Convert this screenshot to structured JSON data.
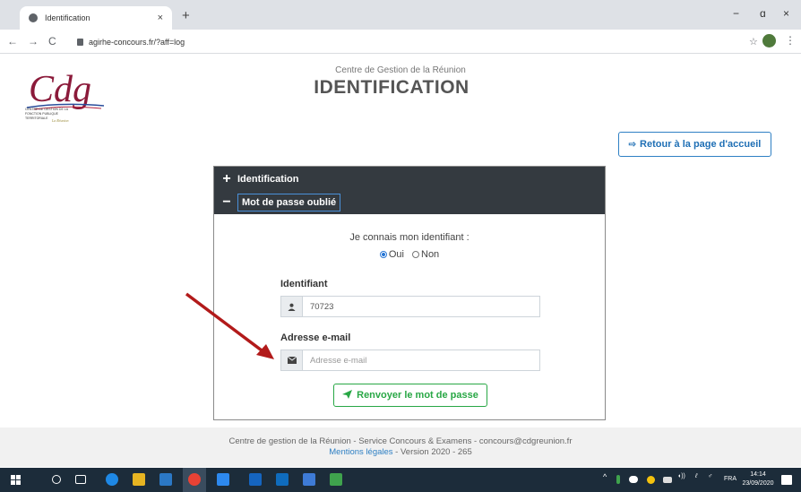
{
  "browser": {
    "tab_title": "Identification",
    "tab_close": "×",
    "new_tab": "+",
    "url": "agirhe-concours.fr/?aff=log",
    "back": "←",
    "forward": "→",
    "reload": "C",
    "bookmark": "☆",
    "menu": "⋮",
    "minimize": "−",
    "maximize": "ɑ",
    "close": "×"
  },
  "logo": {
    "text": "Cdg",
    "subtitle": "CENTRE DE GESTION DE LA FONCTION PUBLIQUE TERRITORIALE",
    "place": "La Réunion"
  },
  "header": {
    "org": "Centre de Gestion de la Réunion",
    "title": "IDENTIFICATION"
  },
  "home_button": {
    "label": "Retour à la page d'accueil",
    "icon": "sign-out-icon"
  },
  "accordion": [
    {
      "symbol": "+",
      "label": "Identification"
    },
    {
      "symbol": "−",
      "label": "Mot de passe oublié"
    }
  ],
  "form": {
    "question": "Je connais mon identifiant :",
    "option_yes": "Oui",
    "option_no": "Non",
    "selected": "Oui",
    "id_label": "Identifiant",
    "id_value": "70723",
    "email_label": "Adresse e-mail",
    "email_placeholder": "Adresse e-mail",
    "submit": "Renvoyer le mot de passe"
  },
  "footer": {
    "line1": "Centre de gestion de la Réunion - Service Concours & Examens - concours@cdgreunion.fr",
    "legal": "Mentions légales",
    "version": " - Version 2020 - 265"
  },
  "taskbar": {
    "lang": "FRA",
    "time": "14:14",
    "date": "23/09/2020"
  },
  "colors": {
    "accent_blue": "#2f80c4",
    "accordion_dark": "#343a40",
    "success_green": "#28a745",
    "arrow_red": "#b21a1a",
    "taskbar": "#1c2c3a"
  }
}
